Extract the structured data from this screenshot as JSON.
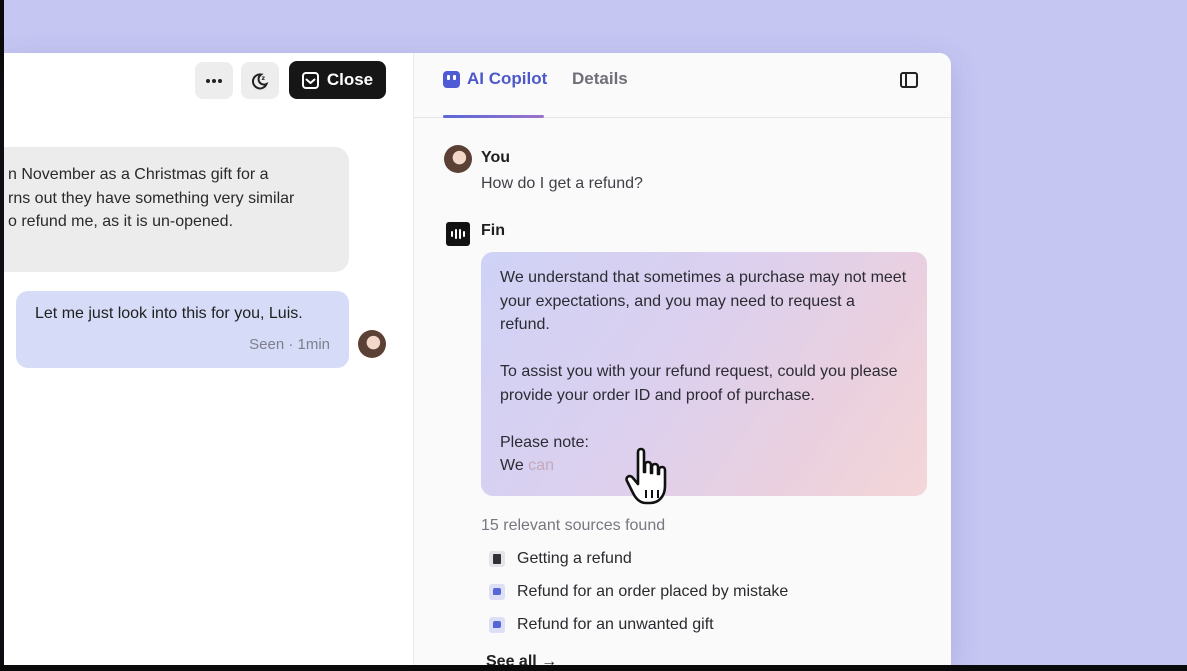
{
  "conversation": {
    "toolbar": {
      "more_icon": "more-horizontal-icon",
      "snooze_icon": "snooze-moon-icon",
      "close_label": "Close"
    },
    "messages": [
      {
        "author": "customer",
        "lines": [
          "n November as a Christmas gift for a",
          "rns out they have something very similar",
          "o refund me, as it is un-opened."
        ]
      },
      {
        "author": "agent",
        "text": "Let me just look into this for you, Luis.",
        "meta": "Seen · 1min"
      }
    ]
  },
  "copilot": {
    "tabs": [
      {
        "label": "AI Copilot",
        "active": true
      },
      {
        "label": "Details",
        "active": false
      }
    ],
    "user": {
      "name": "You",
      "message": "How do I get a refund?"
    },
    "fin": {
      "name": "Fin",
      "paragraphs": [
        "We understand that sometimes a purchase may not meet your expectations, and you may need to request a refund.",
        "To assist you with your refund request, could you please provide your order ID and proof of purchase."
      ],
      "note_heading": "Please note:",
      "streaming_prefix": "We",
      "streaming_faded": "can"
    },
    "sources_count": "15 relevant sources found",
    "sources": [
      {
        "label": "Getting a refund",
        "icon": "book-icon"
      },
      {
        "label": "Refund for an order placed by mistake",
        "icon": "chat-bubble-icon"
      },
      {
        "label": "Refund for an unwanted gift",
        "icon": "chat-bubble-icon"
      }
    ],
    "see_all": "See all →"
  },
  "colors": {
    "background": "#c6c6f3",
    "accent": "#4d59c8",
    "agent_bubble": "#d6dcf7",
    "close_button": "#161616"
  }
}
